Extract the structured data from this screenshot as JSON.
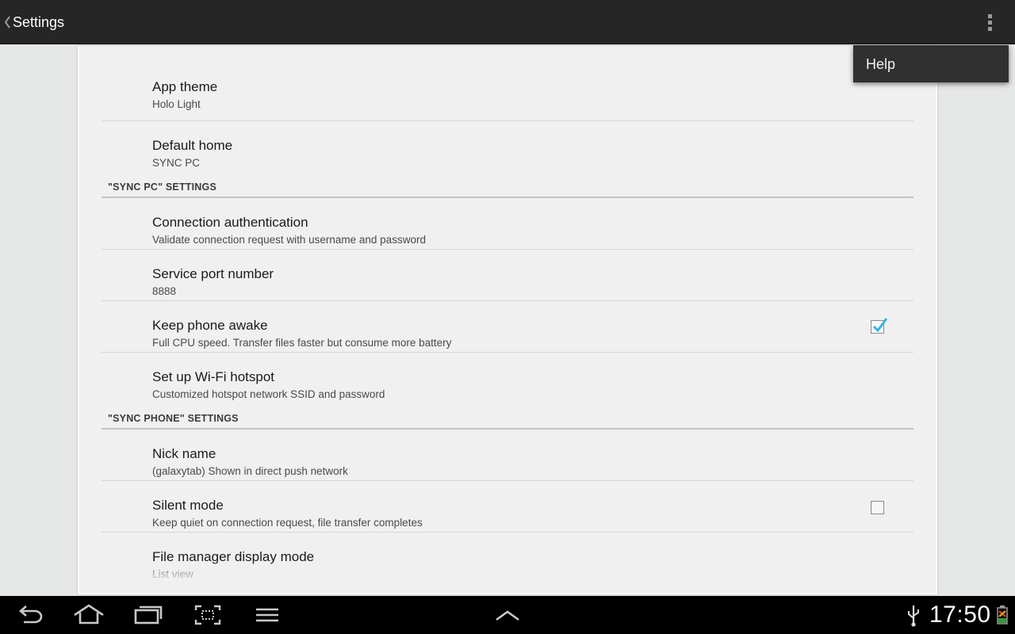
{
  "actionbar": {
    "title": "Settings",
    "back_icon": "chevron-left-icon",
    "overflow_icon": "overflow-menu-icon"
  },
  "popup_menu": {
    "items": [
      {
        "label": "Help"
      }
    ]
  },
  "prefs_top": [
    {
      "title": "App theme",
      "summary": "Holo Light"
    },
    {
      "title": "Default home",
      "summary": "SYNC PC"
    }
  ],
  "cat_pc": "\"SYNC PC\" SETTINGS",
  "prefs_pc": [
    {
      "title": "Connection authentication",
      "summary": "Validate connection request with username and password"
    },
    {
      "title": "Service port number",
      "summary": "8888"
    },
    {
      "title": "Keep phone awake",
      "summary": "Full CPU speed. Transfer files faster but consume more battery",
      "checked": true
    },
    {
      "title": "Set up Wi-Fi hotspot",
      "summary": "Customized hotspot network SSID and password"
    }
  ],
  "cat_phone": "\"SYNC PHONE\" SETTINGS",
  "prefs_phone": [
    {
      "title": "Nick name",
      "summary": "(galaxytab) Shown in direct push network"
    },
    {
      "title": "Silent mode",
      "summary": "Keep quiet on connection request, file transfer completes",
      "checked": false
    },
    {
      "title": "File manager display mode",
      "summary": "List view"
    }
  ],
  "system_bar": {
    "clock": "17:50",
    "buttons": [
      "back-icon",
      "home-icon",
      "recent-apps-icon",
      "screenshot-icon",
      "menu-icon",
      "chevron-up-icon"
    ],
    "status_icons": [
      "usb-icon",
      "battery-icon"
    ]
  },
  "colors": {
    "accent_check": "#33b5e5",
    "actionbar_bg": "#262626",
    "panel_bg": "#f0f0f0"
  }
}
